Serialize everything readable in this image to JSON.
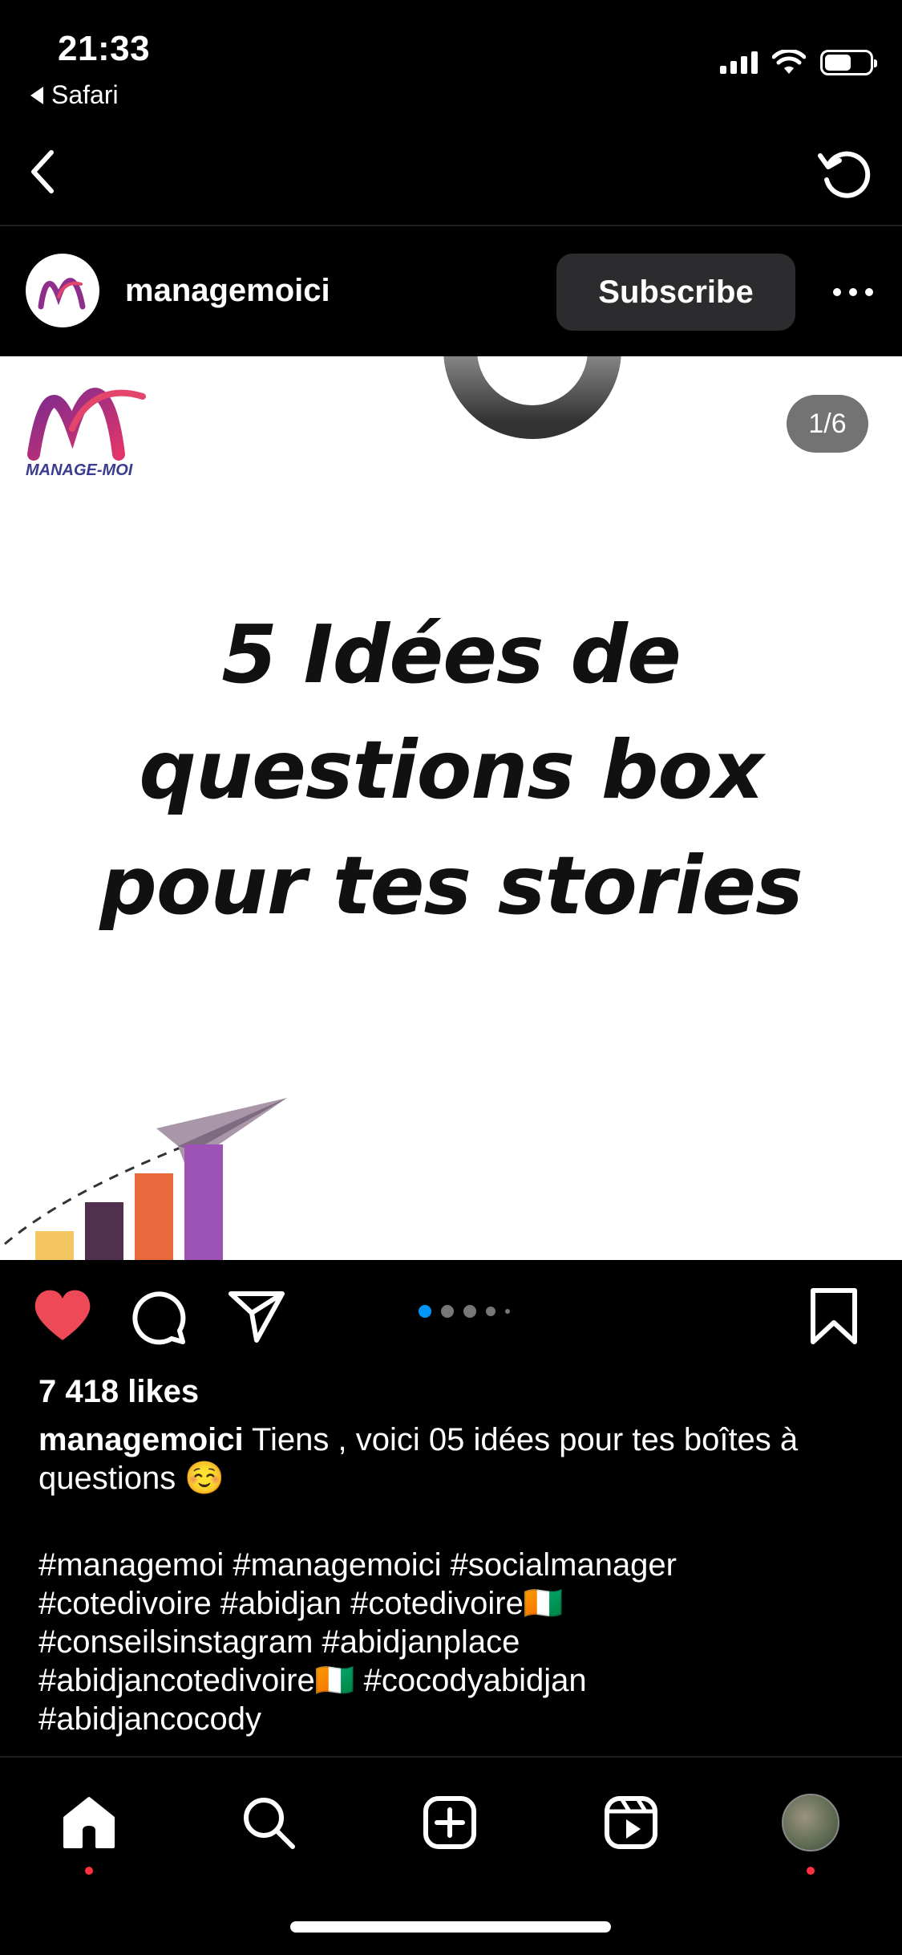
{
  "status_bar": {
    "time": "21:33",
    "back_app": "Safari",
    "icons": [
      "cellular-signal-icon",
      "wifi-icon",
      "battery-icon"
    ]
  },
  "nav": {
    "back_icon": "chevron-left-icon",
    "refresh_icon": "refresh-icon"
  },
  "post": {
    "username": "managemoici",
    "subscribe_label": "Subscribe",
    "more_icon": "more-horizontal-icon",
    "logo_text": "MANAGE-MOI",
    "counter": "1/6",
    "headline_lines": [
      "5 Idées de",
      "questions box",
      "pour tes stories"
    ],
    "carousel": {
      "total_dots": 5,
      "active_index": 0
    },
    "likes": "7 418 likes",
    "caption_user": "managemoici",
    "caption_text": " Tiens , voici 05 idées pour tes boîtes à questions ☺️",
    "hashtags": "#managemoi #managemoici #socialmanager\n#cotedivoire #abidjan #cotedivoire🇨🇮\n#conseilsinstagram #abidjanplace\n#abidjancotedivoire🇨🇮 #cocodyabidjan\n#abidjancocody"
  },
  "illustration_bars": [
    {
      "color": "#f3c662",
      "value": 1
    },
    {
      "color": "#51304e",
      "value": 2
    },
    {
      "color": "#e8693b",
      "value": 3
    },
    {
      "color": "#9c53b5",
      "value": 4
    }
  ],
  "colors": {
    "like_red": "#ed4956",
    "active_dot": "#0095f6",
    "notif_dot": "#ff3040"
  },
  "tab_bar": [
    "home-icon",
    "search-icon",
    "create-post-icon",
    "reels-icon",
    "profile-avatar"
  ]
}
